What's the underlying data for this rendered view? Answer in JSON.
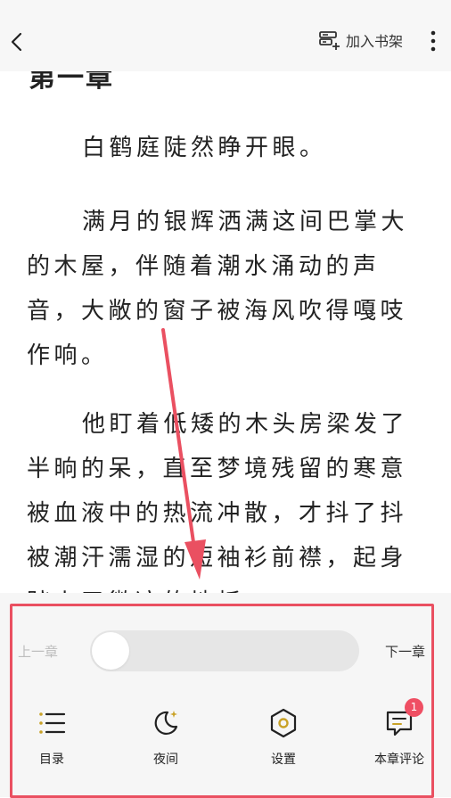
{
  "header": {
    "add_to_shelf_label": "加入书架"
  },
  "reader": {
    "chapter_title": "第一章",
    "paragraphs": [
      "白鹤庭陡然睁开眼。",
      "满月的银辉洒满这间巴掌大的木屋，伴随着潮水涌动的声音，大敞的窗子被海风吹得嘎吱作响。",
      "他盯着低矮的木头房梁发了半晌的呆，直至梦境残留的寒意被血液中的热流冲散，才抖了抖被潮汗濡湿的短袖衫前襟，起身踏上了微凉的地板。"
    ]
  },
  "panel": {
    "prev_chapter": "上一章",
    "next_chapter": "下一章",
    "progress": 0,
    "nav": {
      "toc": "目录",
      "night": "夜间",
      "settings": "设置",
      "comments": "本章评论",
      "comments_badge": "1"
    }
  },
  "colors": {
    "accent_gold": "#c9a227",
    "badge": "#ef4f63",
    "annotation": "#ea5061",
    "panel_bg": "#f6f6f6"
  },
  "icons": [
    "back-icon",
    "bookshelf-icon",
    "more-icon",
    "toc-icon",
    "moon-icon",
    "settings-icon",
    "comment-icon"
  ]
}
